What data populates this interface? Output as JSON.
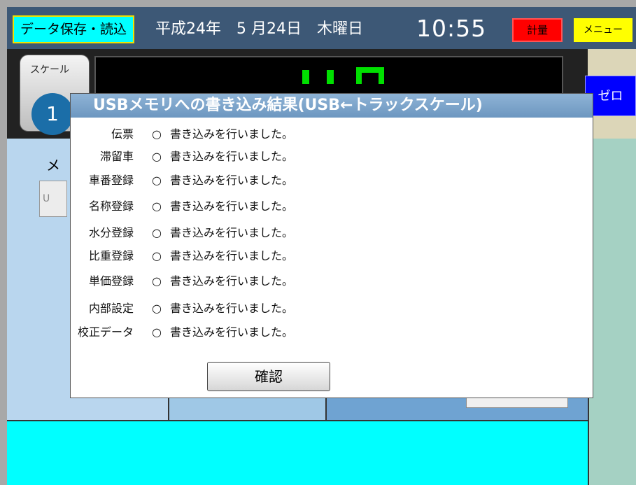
{
  "header": {
    "data_button_label": "データ保存・読込",
    "date_text": "平成24年　5 月24日　木曜日",
    "time_text": "10:55",
    "weigh_button_label": "計量",
    "menu_button_label": "メニュー"
  },
  "scale": {
    "label": "スケール",
    "number": "1",
    "zero_button_label": "ゼロ"
  },
  "background": {
    "me_label": "メ",
    "left_box_text": "U"
  },
  "dialog": {
    "title": "USBメモリへの書き込み結果(USB←トラックスケール)",
    "rows": [
      {
        "name": "伝票",
        "mark": "○",
        "message": "書き込みを行いました。"
      },
      {
        "name": "滞留車",
        "mark": "○",
        "message": "書き込みを行いました。"
      },
      {
        "name": "車番登録",
        "mark": "○",
        "message": "書き込みを行いました。"
      },
      {
        "name": "名称登録",
        "mark": "○",
        "message": "書き込みを行いました。"
      },
      {
        "name": "水分登録",
        "mark": "○",
        "message": "書き込みを行いました。"
      },
      {
        "name": "比重登録",
        "mark": "○",
        "message": "書き込みを行いました。"
      },
      {
        "name": "単価登録",
        "mark": "○",
        "message": "書き込みを行いました。"
      },
      {
        "name": "内部設定",
        "mark": "○",
        "message": "書き込みを行いました。"
      },
      {
        "name": "校正データ",
        "mark": "○",
        "message": "書き込みを行いました。"
      }
    ],
    "confirm_label": "確認"
  },
  "colors": {
    "topbar": "#3d5876",
    "data_button": "#00ffff",
    "weigh_button": "#ff0000",
    "menu_button": "#ffff00",
    "zero_button": "#0000ff",
    "display_digits": "#00e000",
    "bottom_panel": "#00ffff"
  }
}
